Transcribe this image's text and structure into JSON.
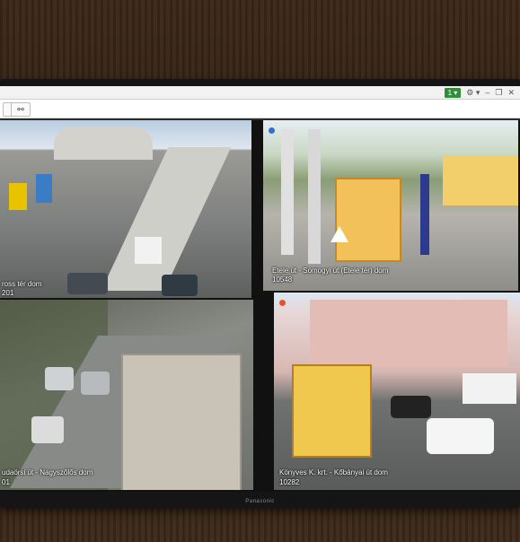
{
  "window": {
    "monitor_select": "1 ▾",
    "controls": [
      "⚙ ▾",
      "–",
      "❐",
      "✕"
    ]
  },
  "toolbar": {
    "buttons": [
      {
        "icon": "layout-grid-icon",
        "glyph": "⚲"
      },
      {
        "icon": "network-icon",
        "glyph": "⚯"
      }
    ]
  },
  "device": {
    "brand": "Panasonic"
  },
  "cameras": [
    {
      "title": "ross tér dom",
      "id": "201"
    },
    {
      "title": "Etele út - Somogyi út (Etele tér) dom",
      "id": "10548",
      "indicator_color": "#2f6fd6"
    },
    {
      "title": "udaörsi út - Nagyszőlős dom",
      "id": "01"
    },
    {
      "title": "Könyves K. krt. - Kőbányai út dom",
      "id": "10282",
      "indicator_color": "#e8502a"
    }
  ]
}
